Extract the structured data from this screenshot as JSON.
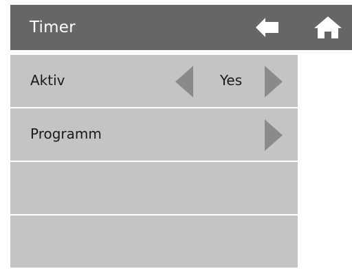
{
  "header": {
    "title": "Timer",
    "back_icon": "back-arrow-icon",
    "home_icon": "home-icon"
  },
  "menu": {
    "rows": [
      {
        "label": "Aktiv",
        "value": "Yes"
      },
      {
        "label": "Programm"
      },
      {
        "label": ""
      },
      {
        "label": ""
      }
    ]
  },
  "colors": {
    "header_bg": "#666666",
    "row_bg": "#c4c4c4",
    "arrow": "#8a8a8a",
    "icon": "#ffffff"
  }
}
